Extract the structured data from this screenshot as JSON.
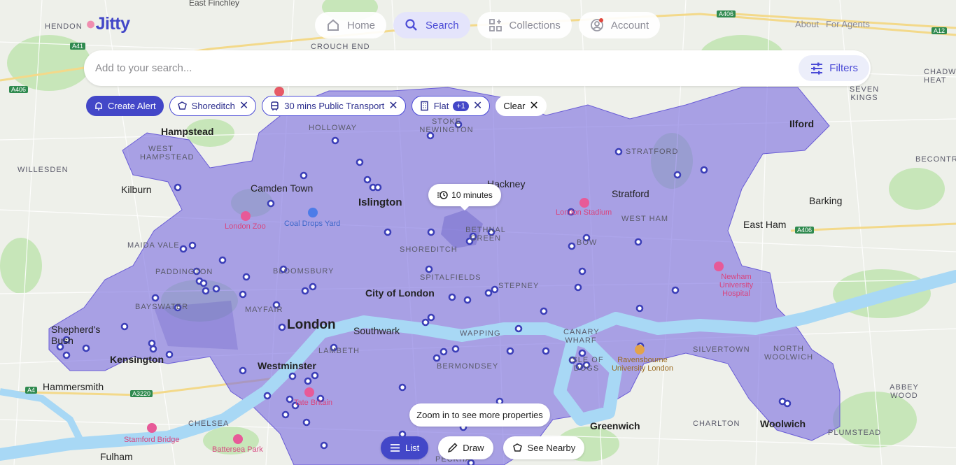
{
  "nav": {
    "home": "Home",
    "search": "Search",
    "collections": "Collections",
    "account": "Account",
    "about": "About",
    "for_agents": "For Agents"
  },
  "brand": {
    "accent": "#4347c8",
    "logo_text": "Jitty"
  },
  "search": {
    "placeholder": "Add to your search...",
    "filters_label": "Filters"
  },
  "chips": {
    "create_alert": "Create Alert",
    "location": "Shoreditch",
    "commute": "30 mins Public Transport",
    "property_type": "Flat",
    "property_type_extra": "+1",
    "clear": "Clear"
  },
  "map": {
    "tooltip": "10 minutes",
    "zoom_hint": "Zoom in to see more properties",
    "labels": {
      "east_finchley": "East Finchley",
      "hendon": "HENDON",
      "crouch_end": "CROUCH END",
      "hampstead": "Hampstead",
      "west_hampstead": "WEST HAMPSTEAD",
      "willesden": "WILLESDEN",
      "kilburn": "Kilburn",
      "camden": "Camden Town",
      "holloway": "HOLLOWAY",
      "stoke_newington": "STOKE NEWINGTON",
      "islington": "Islington",
      "hackney": "Hackney",
      "stratford": "Stratford",
      "s_tratford": "STRATFORD",
      "ilford": "Ilford",
      "seven_kings": "SEVEN KINGS",
      "chadwell_heath": "CHADW HEAT",
      "becontree": "BECONTR",
      "barking": "Barking",
      "east_ham": "East Ham",
      "west_ham": "WEST HAM",
      "bow": "BOW",
      "london_zoo": "London Zoo",
      "coal_drops": "Coal Drops Yard",
      "maida_vale": "MAIDA VALE",
      "shoreditch": "SHOREDITCH",
      "bethnal_green": "BETHNAL GREEN",
      "london_stadium": "London Stadium",
      "paddington": "PADDINGTON",
      "bayswater": "BAYSWATER",
      "bloomsbury": "BLOOMSBURY",
      "spitalfields": "SPITALFIELDS",
      "stepney": "STEPNEY",
      "city_of_london": "City of London",
      "mayfair": "MAYFAIR",
      "london": "London",
      "newham_hospital": "Newham University Hospital",
      "shepherds_bush": "Shepherd's Bush",
      "kensington": "Kensington",
      "southwark": "Southwark",
      "wapping": "WAPPING",
      "canary_wharf": "CANARY WHARF",
      "isle_of_dogs": "ISLE OF DOGS",
      "ravensbourne": "Ravensbourne University London",
      "silvertown": "SILVERTOWN",
      "north_woolwich": "NORTH WOOLWICH",
      "westminster": "Westminster",
      "lambeth": "LAMBETH",
      "bermondsey": "BERMONDSEY",
      "hammersmith": "Hammersmith",
      "chelsea": "CHELSEA",
      "tate_britain": "Tate Britain",
      "abbey_wood": "ABBEY WOOD",
      "charlton": "CHARLTON",
      "woolwich": "Woolwich",
      "plumstead": "PLUMSTEAD",
      "greenwich": "Greenwich",
      "stamford_bridge": "Stamford Bridge",
      "battersea_park": "Battersea Park",
      "fulham": "Fulham",
      "peckham": "PECKHA"
    },
    "roads": {
      "a41": "A41",
      "a406_w": "A406",
      "a406_n": "A406",
      "a12": "A12",
      "a406_e": "A406",
      "a4": "A4",
      "a3220": "A3220"
    }
  },
  "bottom": {
    "list": "List",
    "draw": "Draw",
    "see_nearby": "See Nearby"
  }
}
